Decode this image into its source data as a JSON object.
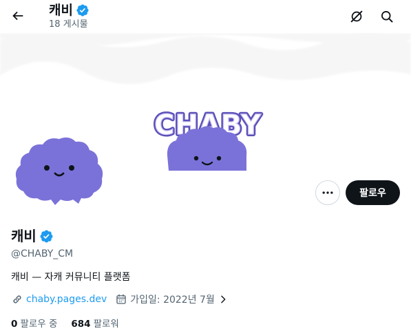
{
  "header": {
    "title": "캐비",
    "post_count": "18 게시물"
  },
  "banner": {
    "logo_text": "CHABY"
  },
  "profile": {
    "name": "캐비",
    "handle": "@CHABY_CM",
    "bio": "캐비 — 자캐 커뮤니티 플랫폼",
    "link": "chaby.pages.dev",
    "joined": "가입일: 2022년 7월"
  },
  "actions": {
    "follow_label": "팔로우"
  },
  "stats": {
    "following_count": "0",
    "following_label": "팔로우 중",
    "followers_count": "684",
    "followers_label": "팔로워"
  },
  "colors": {
    "accent": "#1d9bf0",
    "mascot": "#7b72d9",
    "mascot_outline": "#5b4fb8",
    "text_secondary": "#536471",
    "button_dark": "#0f1419"
  },
  "icons": {
    "back": "arrow-left-icon",
    "verified": "verified-badge-icon",
    "grok": "grok-icon",
    "search": "search-icon",
    "more": "more-horizontal-icon",
    "link": "link-icon",
    "calendar": "calendar-icon",
    "chevron": "chevron-right-icon"
  }
}
